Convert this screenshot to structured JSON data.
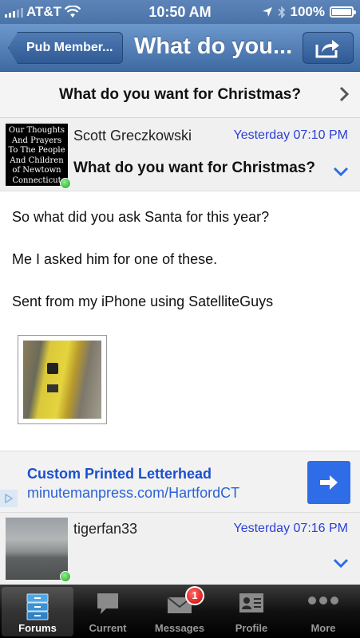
{
  "status_bar": {
    "carrier": "AT&T",
    "time": "10:50 AM",
    "battery": "100%"
  },
  "nav": {
    "back_label": "Pub Member...",
    "title": "What do you..."
  },
  "thread": {
    "title": "What do you want for Christmas?"
  },
  "post": {
    "avatar_text": [
      "Our Thoughts",
      "And Prayers",
      "To The People",
      "And Children",
      "of Newtown",
      "Connecticut"
    ],
    "username": "Scott Greczkowski",
    "timestamp": "Yesterday 07:10 PM",
    "title": "What do you want for Christmas?",
    "body": [
      "So what did you ask Santa for this year?",
      "Me I asked him for one of these.",
      "Sent from my iPhone using SatelliteGuys"
    ]
  },
  "ad": {
    "title": "Custom Printed Letterhead",
    "url": "minutemanpress.com/HartfordCT"
  },
  "post2": {
    "username": "tigerfan33",
    "timestamp": "Yesterday 07:16 PM"
  },
  "tabs": [
    {
      "label": "Forums",
      "icon": "forums-icon"
    },
    {
      "label": "Current",
      "icon": "current-icon"
    },
    {
      "label": "Messages",
      "icon": "messages-icon",
      "badge": "1"
    },
    {
      "label": "Profile",
      "icon": "profile-icon"
    },
    {
      "label": "More",
      "icon": "more-icon"
    }
  ],
  "colors": {
    "nav_blue": "#3e6aa3",
    "link_blue": "#2b3fd6",
    "ad_button": "#2f6de8",
    "online_green": "#1fa31f",
    "badge_red": "#d00000"
  }
}
